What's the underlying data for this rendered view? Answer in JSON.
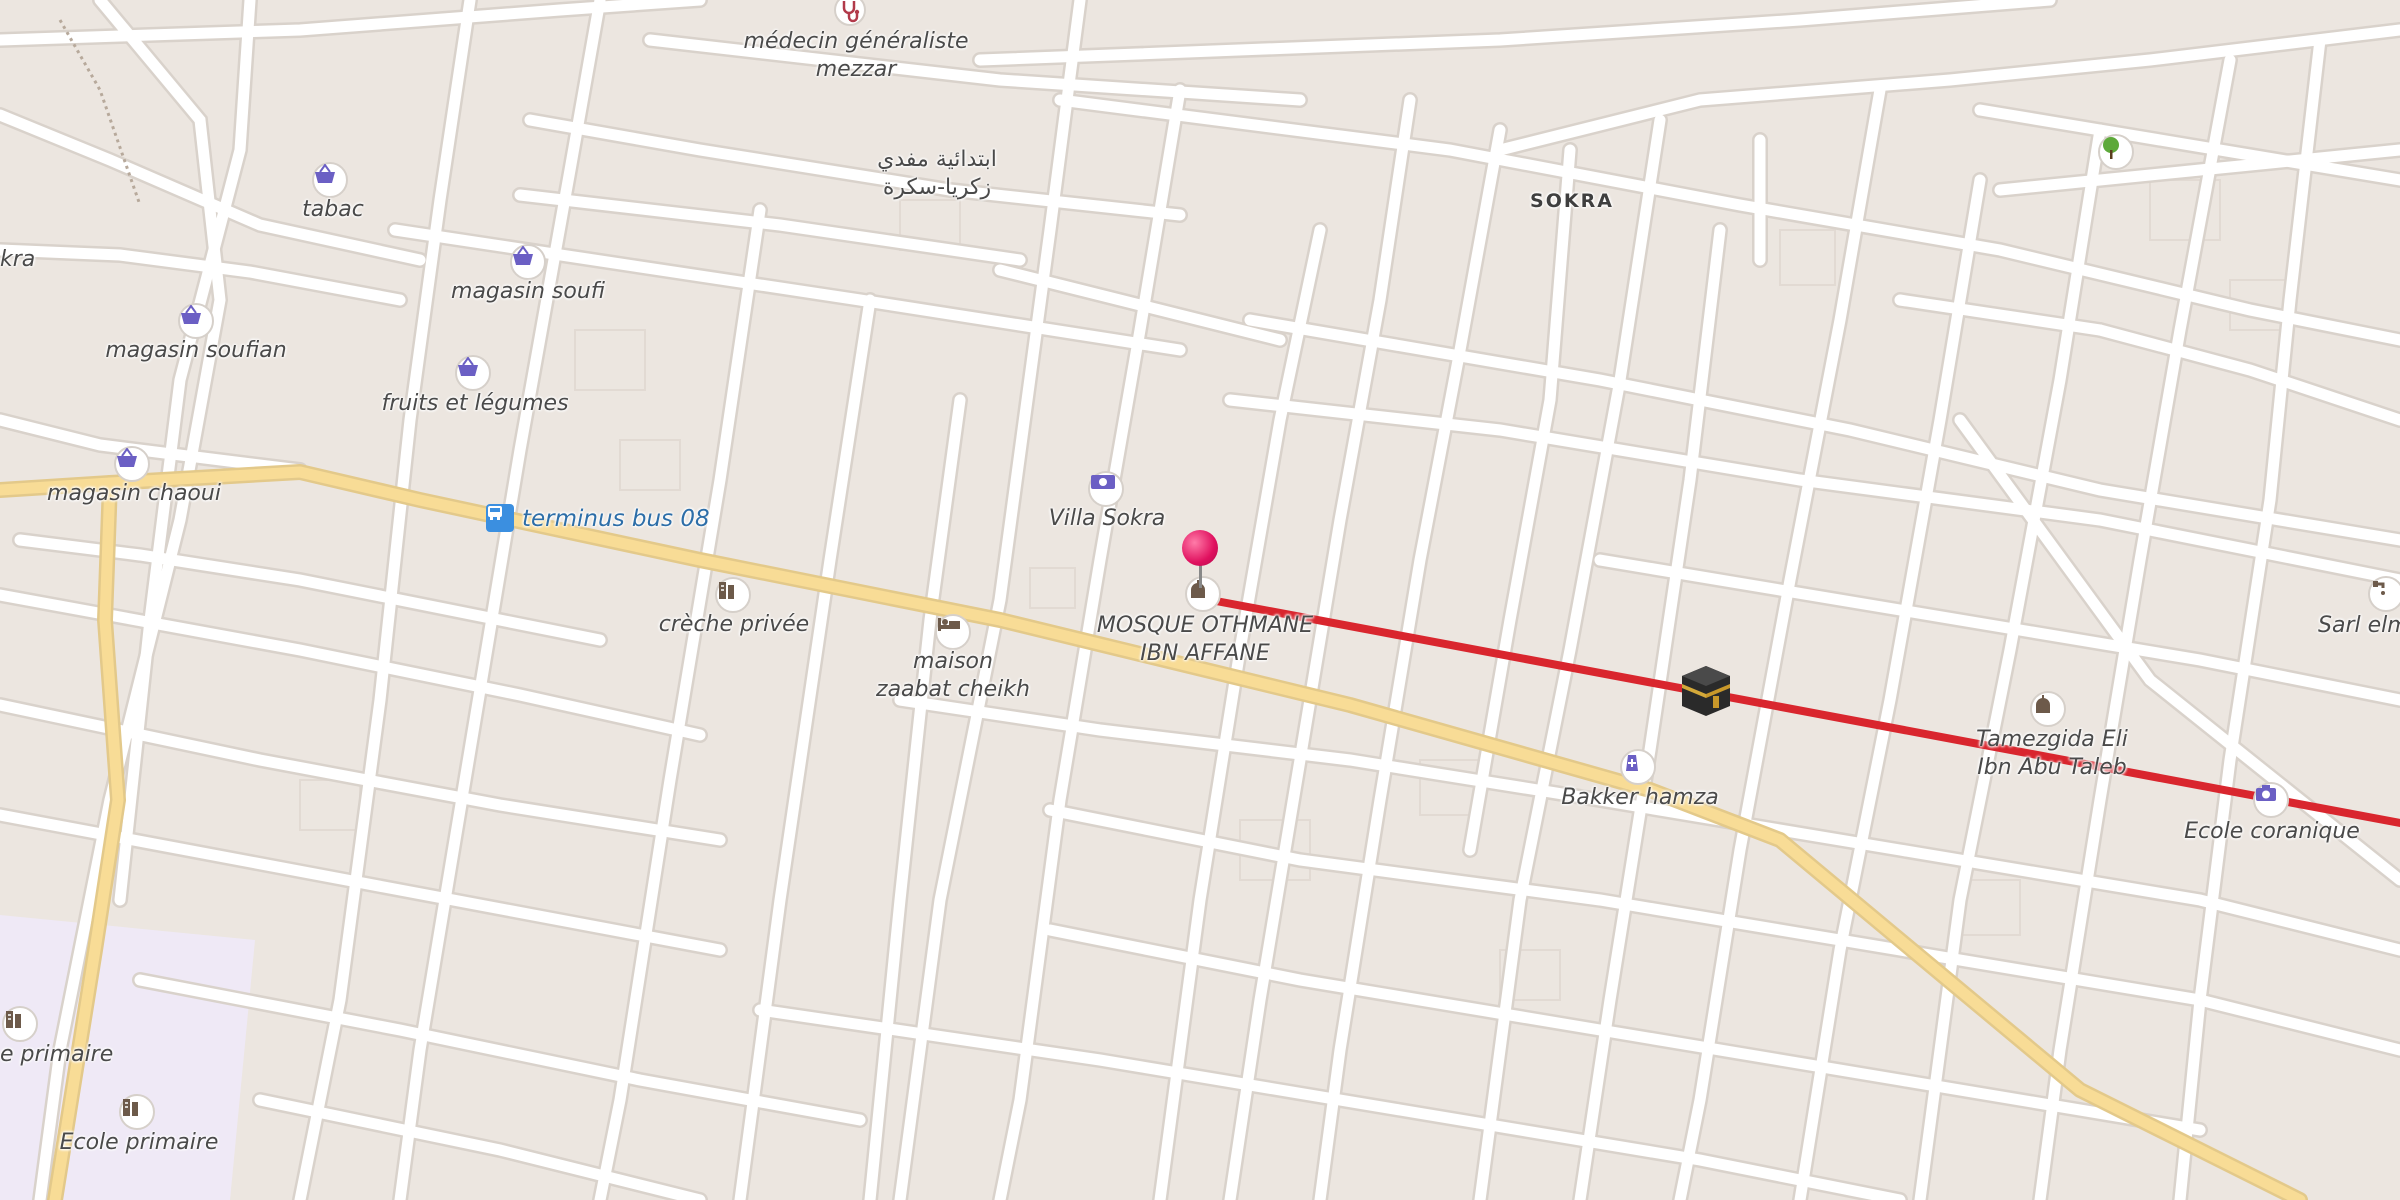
{
  "map": {
    "labels": {
      "medecin": [
        "médecin généraliste",
        "mezzar"
      ],
      "school_ar": [
        "ابتدائية مفدي",
        "زكريا-سكرة"
      ],
      "sokra": "SOKRA",
      "tabac": "tabac",
      "kra": "kra",
      "magasin_soufi": "magasin soufi",
      "magasin_soufian": "magasin soufian",
      "fruits": "fruits et légumes",
      "magasin_chaoui": "magasin chaoui",
      "terminus": "terminus bus 08",
      "villa": "Villa Sokra",
      "creche": "crèche privée",
      "mosque": [
        "MOSQUE OTHMANE",
        "IBN AFFANE"
      ],
      "maison": [
        "maison",
        "zaabat cheikh"
      ],
      "bakker": "Bakker hamza",
      "tamezgida": [
        "Tamezgida Eli",
        "Ibn Abu Taleb"
      ],
      "ecole_coranique": "Ecole coranique",
      "sarl": "Sarl elm",
      "primaire_cut": "e primaire",
      "ecole_primaire": "Ecole primaire"
    },
    "icons": [
      "stethoscope-icon",
      "shopping-basket-icon",
      "bus-stop-icon",
      "atm-icon",
      "school-icon",
      "hotel-bed-icon",
      "mosque-icon",
      "pharmacy-icon",
      "camera-icon",
      "tree-icon",
      "tap-icon",
      "location-pin-icon",
      "kaaba-qibla-icon"
    ],
    "colors": {
      "background": "#ece6e0",
      "road": "#ffffff",
      "main_road": "#f8dc96",
      "qibla_line": "#d9262e",
      "poi_purple": "#6b5fc4",
      "pin": "#e0115f",
      "park": "#efe9f6"
    }
  }
}
